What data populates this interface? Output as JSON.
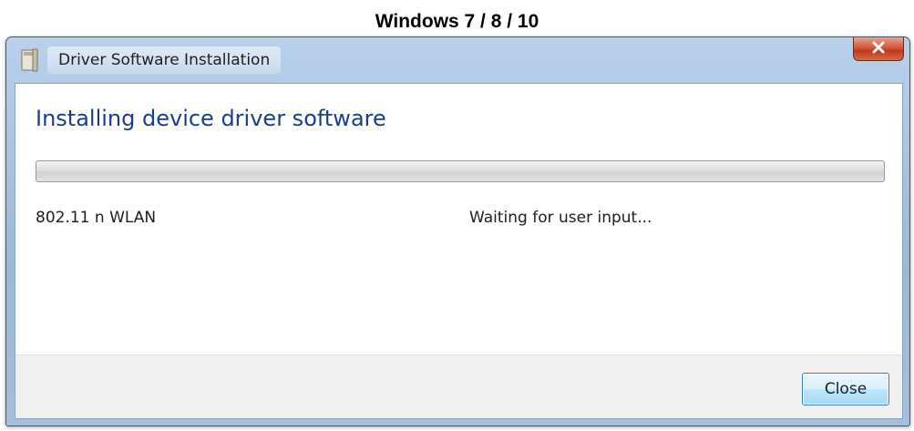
{
  "caption": "Windows 7 / 8 / 10",
  "window": {
    "title": "Driver Software Installation",
    "close_icon": "close-x-icon",
    "app_icon": "driver-install-icon"
  },
  "main": {
    "heading": "Installing device driver software",
    "progress": {
      "value_percent": 0
    },
    "device": {
      "name": "802.11 n WLAN",
      "status": "Waiting for user input..."
    }
  },
  "footer": {
    "close_label": "Close"
  },
  "colors": {
    "heading": "#1a3e8a",
    "close_hover_red": "#c1381d",
    "button_blue": "#3c7fb1"
  }
}
